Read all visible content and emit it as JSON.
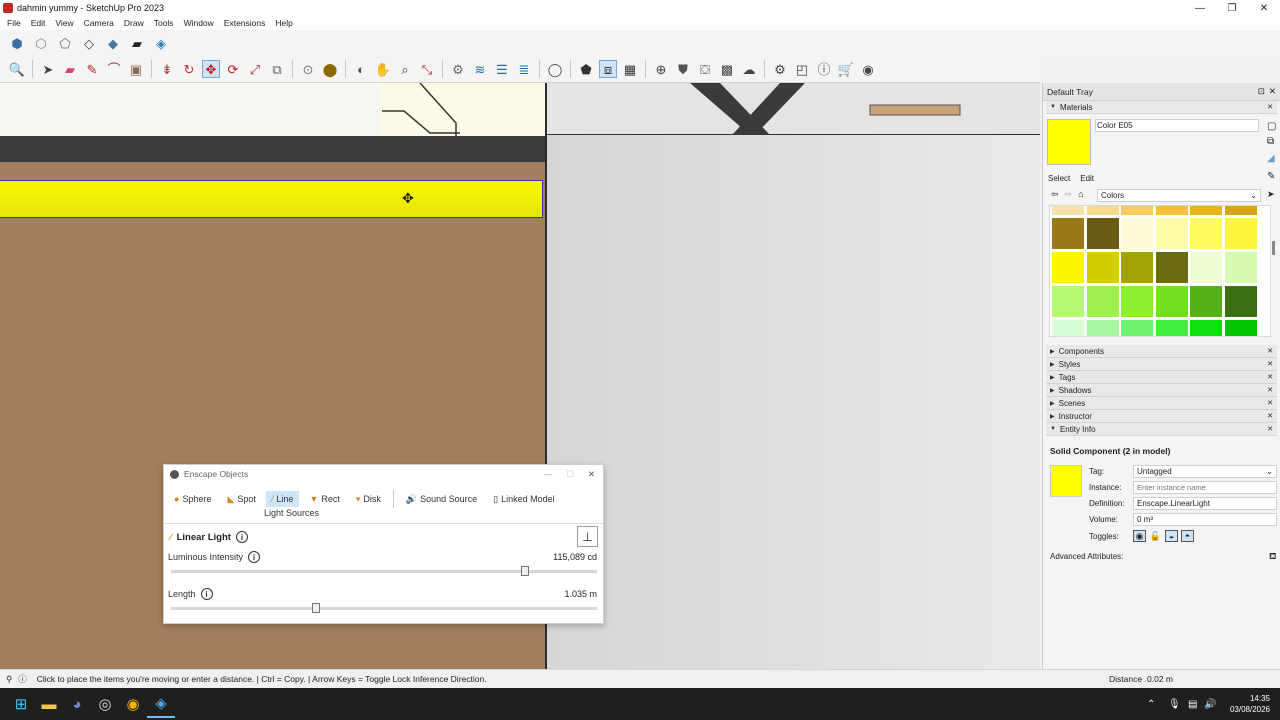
{
  "window": {
    "title": "dahmin yummy - SketchUp Pro 2023",
    "min": "—",
    "restore": "❐",
    "close": "✕"
  },
  "menu": [
    "File",
    "Edit",
    "View",
    "Camera",
    "Draw",
    "Tools",
    "Window",
    "Extensions",
    "Help"
  ],
  "toolbar_primary": [
    "iso-view-icon",
    "top-view-icon",
    "front-view-icon",
    "right-view-icon",
    "back-view-icon",
    "left-view-icon",
    "bottom-view-icon"
  ],
  "tray": {
    "title": "Default Tray",
    "materials": {
      "header": "Materials",
      "name_value": "Color E05",
      "select_tab": "Select",
      "edit_tab": "Edit",
      "library": "Colors"
    },
    "swatch_colors": [
      [
        "#f6e2a8",
        "#f6d88c",
        "#f6cc5e",
        "#f3c23c",
        "#e8b21c",
        "#d6a418"
      ],
      [
        "#9a7a17",
        "#6a5a12",
        "#fffad8",
        "#fffaa6",
        "#fffa60",
        "#fcf63a"
      ],
      [
        "#fcf600",
        "#d0d000",
        "#a2a206",
        "#6a6a10",
        "#eefcd6",
        "#d6fab0"
      ],
      [
        "#b4f870",
        "#a0f050",
        "#8cf030",
        "#70e020",
        "#56b018",
        "#3a7010"
      ],
      [
        "#d8fcd4",
        "#a4f6a0",
        "#70f070",
        "#40f040",
        "#10e010",
        "#00c400"
      ]
    ],
    "sections": [
      "Components",
      "Styles",
      "Tags",
      "Shadows",
      "Scenes",
      "Instructor",
      "Entity Info"
    ],
    "entity": {
      "title": "Solid Component (2 in model)",
      "tag_label": "Tag:",
      "tag_value": "Untagged",
      "instance_label": "Instance:",
      "instance_placeholder": "Enter instance name",
      "definition_label": "Definition:",
      "definition_value": "Enscape.LinearLight",
      "volume_label": "Volume:",
      "volume_value": "0 m³",
      "toggles_label": "Toggles:",
      "advanced": "Advanced Attributes:"
    }
  },
  "enscape": {
    "title": "Enscape Objects",
    "tabs": [
      "Sphere",
      "Spot",
      "Line",
      "Rect",
      "Disk",
      "Sound Source",
      "Linked Model"
    ],
    "group_label": "Light Sources",
    "object_title": "Linear Light",
    "intensity_label": "Luminous Intensity",
    "intensity_value": "115,089 cd",
    "intensity_fraction": 0.83,
    "length_label": "Length",
    "length_value": "1.035 m",
    "length_fraction": 0.34
  },
  "status": {
    "message": "Click to place the items you're moving or enter a distance. | Ctrl = Copy. | Arrow Keys = Toggle Lock Inference Direction.",
    "measure_label": "Distance",
    "measure_value": "0.02 m"
  },
  "taskbar": {
    "time": "14:35",
    "date": "03/08/2026"
  }
}
